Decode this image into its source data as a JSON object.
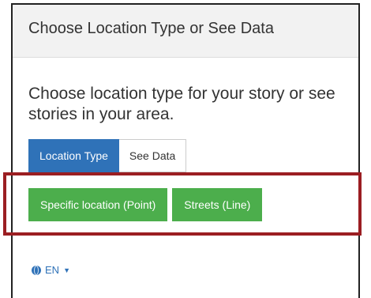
{
  "panel": {
    "title": "Choose Location Type or See Data"
  },
  "intro": {
    "text": "Choose location type for your story or see stories in your area."
  },
  "tabs": [
    {
      "label": "Location Type",
      "active": true
    },
    {
      "label": "See Data",
      "active": false
    }
  ],
  "location_buttons": [
    {
      "label": "Specific location (Point)"
    },
    {
      "label": "Streets (Line)"
    }
  ],
  "language": {
    "label": "EN",
    "icon": "globe-icon",
    "caret_icon": "caret-down-icon"
  },
  "colors": {
    "tab_active": "#2f72b8",
    "button_green": "#4cae4c",
    "highlight_border": "#9b1e22"
  }
}
